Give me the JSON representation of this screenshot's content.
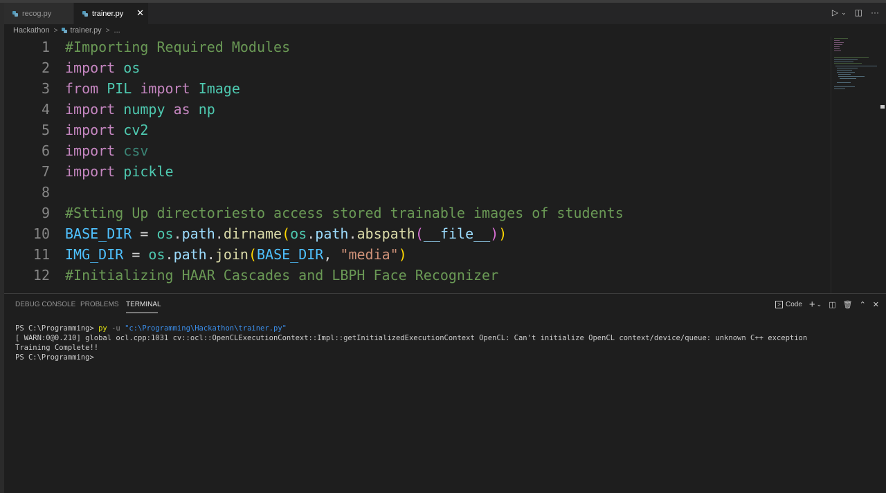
{
  "tabs": [
    {
      "label": "recog.py",
      "active": false
    },
    {
      "label": "trainer.py",
      "active": true
    }
  ],
  "tab_actions": {
    "run_icon": "play-icon",
    "dropdown_icon": "chevron-down-icon",
    "split_icon": "split-editor-icon",
    "more_icon": "ellipsis-icon"
  },
  "breadcrumb": {
    "folder": "Hackathon",
    "file": "trainer.py",
    "more": "..."
  },
  "editor": {
    "lines": [
      {
        "n": "1",
        "parts": [
          {
            "t": "#Importing Required Modules",
            "c": "cmt"
          }
        ]
      },
      {
        "n": "2",
        "parts": [
          {
            "t": "import",
            "c": "kw"
          },
          {
            "t": " ",
            "c": "plain"
          },
          {
            "t": "os",
            "c": "mod"
          }
        ]
      },
      {
        "n": "3",
        "parts": [
          {
            "t": "from",
            "c": "kw"
          },
          {
            "t": " ",
            "c": "plain"
          },
          {
            "t": "PIL",
            "c": "mod"
          },
          {
            "t": " ",
            "c": "plain"
          },
          {
            "t": "import",
            "c": "kw"
          },
          {
            "t": " ",
            "c": "plain"
          },
          {
            "t": "Image",
            "c": "mod"
          }
        ]
      },
      {
        "n": "4",
        "parts": [
          {
            "t": "import",
            "c": "kw"
          },
          {
            "t": " ",
            "c": "plain"
          },
          {
            "t": "numpy",
            "c": "mod"
          },
          {
            "t": " ",
            "c": "plain"
          },
          {
            "t": "as",
            "c": "kw"
          },
          {
            "t": " ",
            "c": "plain"
          },
          {
            "t": "np",
            "c": "mod"
          }
        ]
      },
      {
        "n": "5",
        "parts": [
          {
            "t": "import",
            "c": "kw"
          },
          {
            "t": " ",
            "c": "plain"
          },
          {
            "t": "cv2",
            "c": "mod"
          }
        ]
      },
      {
        "n": "6",
        "parts": [
          {
            "t": "import",
            "c": "kw"
          },
          {
            "t": " ",
            "c": "plain"
          },
          {
            "t": "csv",
            "c": "dim"
          }
        ]
      },
      {
        "n": "7",
        "parts": [
          {
            "t": "import",
            "c": "kw"
          },
          {
            "t": " ",
            "c": "plain"
          },
          {
            "t": "pickle",
            "c": "mod"
          }
        ]
      },
      {
        "n": "8",
        "parts": []
      },
      {
        "n": "9",
        "parts": [
          {
            "t": "#Stting Up directoriesto access stored trainable images of students",
            "c": "cmt"
          }
        ]
      },
      {
        "n": "10",
        "parts": [
          {
            "t": "BASE_DIR",
            "c": "var"
          },
          {
            "t": " = ",
            "c": "plain"
          },
          {
            "t": "os",
            "c": "mod"
          },
          {
            "t": ".",
            "c": "plain"
          },
          {
            "t": "path",
            "c": "param"
          },
          {
            "t": ".",
            "c": "plain"
          },
          {
            "t": "dirname",
            "c": "fn"
          },
          {
            "t": "(",
            "c": "p1"
          },
          {
            "t": "os",
            "c": "mod"
          },
          {
            "t": ".",
            "c": "plain"
          },
          {
            "t": "path",
            "c": "param"
          },
          {
            "t": ".",
            "c": "plain"
          },
          {
            "t": "abspath",
            "c": "fn"
          },
          {
            "t": "(",
            "c": "p2"
          },
          {
            "t": "__file__",
            "c": "param"
          },
          {
            "t": ")",
            "c": "p2"
          },
          {
            "t": ")",
            "c": "p1"
          }
        ]
      },
      {
        "n": "11",
        "parts": [
          {
            "t": "IMG_DIR",
            "c": "var"
          },
          {
            "t": " = ",
            "c": "plain"
          },
          {
            "t": "os",
            "c": "mod"
          },
          {
            "t": ".",
            "c": "plain"
          },
          {
            "t": "path",
            "c": "param"
          },
          {
            "t": ".",
            "c": "plain"
          },
          {
            "t": "join",
            "c": "fn"
          },
          {
            "t": "(",
            "c": "p1"
          },
          {
            "t": "BASE_DIR",
            "c": "var"
          },
          {
            "t": ", ",
            "c": "plain"
          },
          {
            "t": "\"media\"",
            "c": "str"
          },
          {
            "t": ")",
            "c": "p1"
          }
        ]
      },
      {
        "n": "12",
        "parts": [
          {
            "t": "#Initializing HAAR Cascades and LBPH Face Recognizer",
            "c": "cmt"
          }
        ]
      }
    ]
  },
  "panel": {
    "tabs": [
      {
        "label": "DEBUG CONSOLE",
        "active": false
      },
      {
        "label": "PROBLEMS",
        "active": false
      },
      {
        "label": "TERMINAL",
        "active": true
      }
    ],
    "terminal_profile": "Code",
    "actions": {
      "new_icon": "plus-icon",
      "dropdown_icon": "chevron-down-icon",
      "split_icon": "split-terminal-icon",
      "trash_icon": "trash-icon",
      "maximize_icon": "chevron-up-icon",
      "close_icon": "close-icon"
    }
  },
  "terminal": {
    "prompt1": "PS C:\\Programming> ",
    "cmd": "py",
    "flag": " -u ",
    "path": "\"c:\\Programming\\Hackathon\\trainer.py\"",
    "warn": "[ WARN:0@0.210] global ocl.cpp:1031 cv::ocl::OpenCLExecutionContext::Impl::getInitializedExecutionContext OpenCL: Can't initialize OpenCL context/device/queue: unknown C++ exception",
    "result": "Training Complete!!",
    "prompt2": "PS C:\\Programming>"
  }
}
